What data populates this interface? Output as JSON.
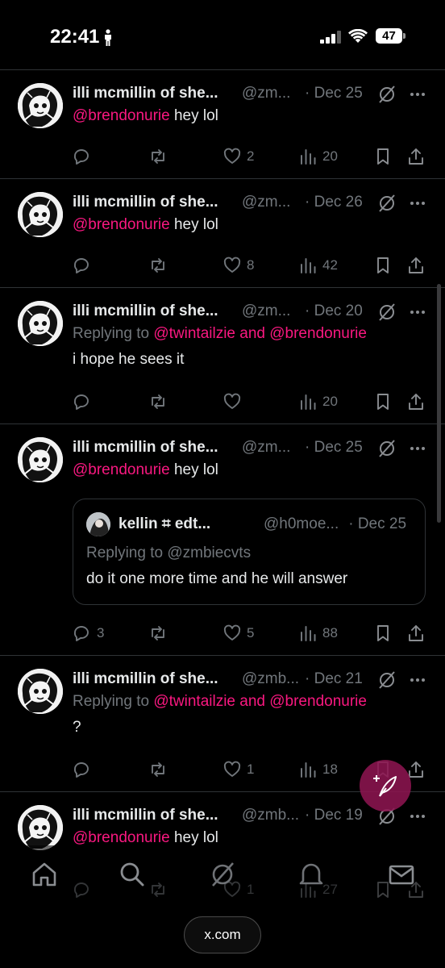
{
  "status_bar": {
    "time": "22:41",
    "battery": "47"
  },
  "tweets": [
    {
      "name": "illi mcmillin of she...",
      "handle": "@zm...",
      "date": "· Dec 25",
      "mention": "@brendonurie",
      "text": " hey lol",
      "reply_count": "",
      "like_count": "2",
      "view_count": "20"
    },
    {
      "name": "illi mcmillin of she...",
      "handle": "@zm...",
      "date": "· Dec 26",
      "mention": "@brendonurie",
      "text": " hey lol",
      "reply_count": "",
      "like_count": "8",
      "view_count": "42"
    },
    {
      "name": "illi mcmillin of she...",
      "handle": "@zm...",
      "date": "· Dec 20",
      "replying_prefix": "Replying to ",
      "replying_users": "@twintailzie and @brendonurie",
      "text": "i hope he sees it",
      "reply_count": "",
      "like_count": "",
      "view_count": "20"
    },
    {
      "name": "illi mcmillin of she...",
      "handle": "@zm...",
      "date": "· Dec 25",
      "mention": "@brendonurie",
      "text": " hey lol",
      "quote": {
        "name": "kellin ⌗ edt...",
        "handle": "@h0moe...",
        "date": "· Dec 25",
        "replying": "Replying to @zmbiecvts",
        "text": "do it one more time and he will answer"
      },
      "reply_count": "3",
      "like_count": "5",
      "view_count": "88"
    },
    {
      "name": "illi mcmillin of she...",
      "handle": "@zmb...",
      "date": "· Dec 21",
      "replying_prefix": "Replying to ",
      "replying_users": "@twintailzie and @brendonurie",
      "text": "?",
      "reply_count": "",
      "like_count": "1",
      "view_count": "18"
    },
    {
      "name": "illi mcmillin of she...",
      "handle": "@zmb...",
      "date": "· Dec 19",
      "mention": "@brendonurie",
      "text": " hey lol",
      "reply_count": "",
      "like_count": "1",
      "view_count": "27"
    }
  ],
  "nav": [
    "home-icon",
    "search-icon",
    "grok-icon",
    "notifications-icon",
    "messages-icon"
  ],
  "url_bar": {
    "domain": "x.com"
  },
  "colors": {
    "accent": "#f91880",
    "muted": "#71767b",
    "text": "#e7e9ea",
    "divider": "#2f3336"
  }
}
